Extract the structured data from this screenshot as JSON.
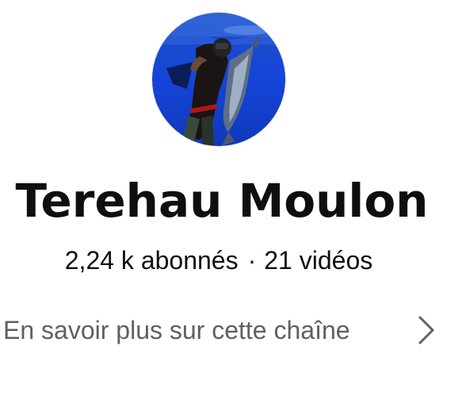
{
  "channel": {
    "name": "Terehau Moulon",
    "subscribers": "2,24 k abonnés",
    "separator": "·",
    "videos": "21 vidéos",
    "more_link": "En savoir plus sur cette chaîne",
    "avatar_icon": "channel-avatar-photo",
    "chevron_icon": "chevron-right-icon"
  }
}
